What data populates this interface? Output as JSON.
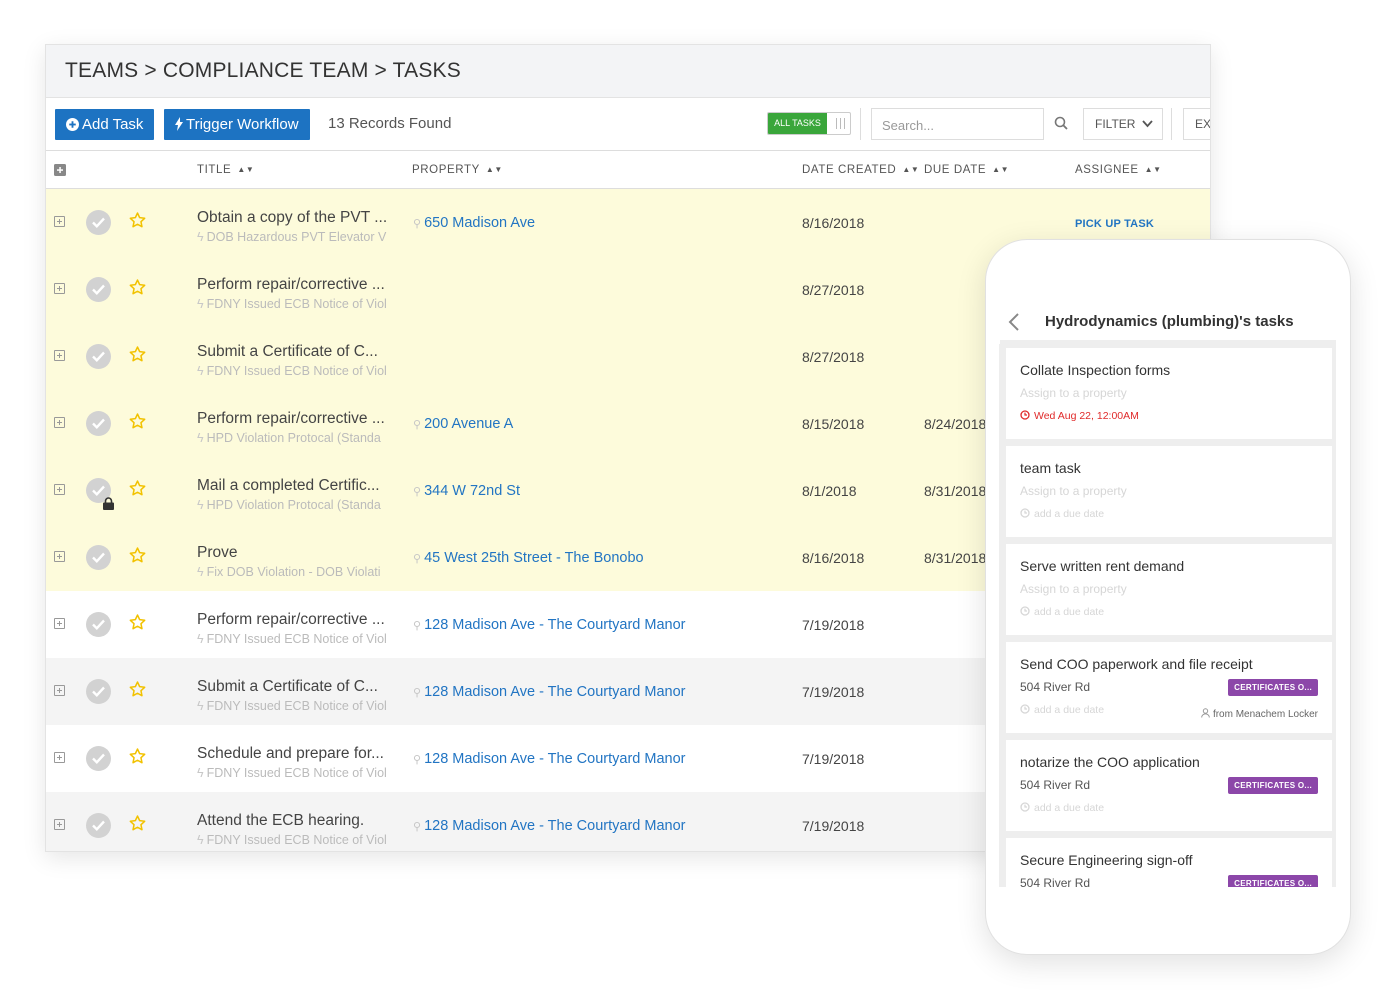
{
  "breadcrumb": "TEAMS > COMPLIANCE TEAM > TASKS",
  "toolbar": {
    "add_task": "Add Task",
    "trigger_workflow": "Trigger Workflow",
    "records": "13 Records Found",
    "toggle_label": "ALL TASKS",
    "search_placeholder": "Search...",
    "filter": "FILTER",
    "export": "EX"
  },
  "columns": {
    "title": "TITLE",
    "property": "PROPERTY",
    "date_created": "DATE CREATED",
    "due_date": "DUE DATE",
    "assignee": "ASSIGNEE"
  },
  "rows": [
    {
      "title": "Obtain a copy of the PVT ...",
      "sub": "DOB Hazardous PVT Elevator V",
      "property": "650 Madison Ave",
      "date_created": "8/16/2018",
      "due_date": "",
      "assignee": "PICK UP TASK",
      "locked": false
    },
    {
      "title": "Perform repair/corrective ...",
      "sub": "FDNY Issued ECB Notice of Viol",
      "property": "",
      "date_created": "8/27/2018",
      "due_date": "",
      "assignee": "",
      "locked": false
    },
    {
      "title": "Submit a Certificate of C...",
      "sub": "FDNY Issued ECB Notice of Viol",
      "property": "",
      "date_created": "8/27/2018",
      "due_date": "",
      "assignee": "",
      "locked": false
    },
    {
      "title": "Perform repair/corrective ...",
      "sub": "HPD Violation Protocal (Standa",
      "property": "200 Avenue A",
      "date_created": "8/15/2018",
      "due_date": "8/24/2018",
      "assignee": "",
      "locked": false
    },
    {
      "title": "Mail a completed Certific...",
      "sub": "HPD Violation Protocal (Standa",
      "property": "344 W 72nd St",
      "date_created": "8/1/2018",
      "due_date": "8/31/2018",
      "assignee": "",
      "locked": true
    },
    {
      "title": "Prove",
      "sub": "Fix DOB Violation - DOB Violati",
      "property": "45 West 25th Street - The Bonobo",
      "date_created": "8/16/2018",
      "due_date": "8/31/2018",
      "assignee": "",
      "locked": false
    },
    {
      "title": "Perform repair/corrective ...",
      "sub": "FDNY Issued ECB Notice of Viol",
      "property": "128 Madison Ave - The Courtyard Manor",
      "date_created": "7/19/2018",
      "due_date": "",
      "assignee": "",
      "locked": false
    },
    {
      "title": "Submit a Certificate of C...",
      "sub": "FDNY Issued ECB Notice of Viol",
      "property": "128 Madison Ave - The Courtyard Manor",
      "date_created": "7/19/2018",
      "due_date": "",
      "assignee": "",
      "locked": false
    },
    {
      "title": "Schedule and prepare for...",
      "sub": "FDNY Issued ECB Notice of Viol",
      "property": "128 Madison Ave - The Courtyard Manor",
      "date_created": "7/19/2018",
      "due_date": "",
      "assignee": "",
      "locked": false
    },
    {
      "title": "Attend the ECB hearing.",
      "sub": "FDNY Issued ECB Notice of Viol",
      "property": "128 Madison Ave - The Courtyard Manor",
      "date_created": "7/19/2018",
      "due_date": "",
      "assignee": "",
      "locked": false
    }
  ],
  "phone": {
    "title": "Hydrodynamics (plumbing)'s tasks",
    "cards": [
      {
        "title": "Collate Inspection forms",
        "property": "Assign to a property",
        "date": "Wed Aug 22, 12:00AM",
        "badge": "",
        "from": ""
      },
      {
        "title": "team task",
        "property": "Assign to a property",
        "date": "add a due date",
        "badge": "",
        "from": ""
      },
      {
        "title": "Serve written rent demand",
        "property": "Assign to a property",
        "date": "add a due date",
        "badge": "",
        "from": ""
      },
      {
        "title": "Send COO paperwork and file receipt",
        "property": "504 River Rd",
        "date": "add a due date",
        "badge": "CERTIFICATES O...",
        "from": "from Menachem Locker"
      },
      {
        "title": "notarize the COO application",
        "property": "504 River Rd",
        "date": "add a due date",
        "badge": "CERTIFICATES O...",
        "from": ""
      },
      {
        "title": "Secure Engineering sign-off",
        "property": "504 River Rd",
        "date": "",
        "badge": "CERTIFICATES O...",
        "from": ""
      }
    ]
  },
  "colors": {
    "primary": "#1d73c2",
    "link": "#2275c3",
    "highlight_row": "#fdfbdb",
    "toggle_on": "#3aa63b",
    "badge": "#8c47a9",
    "overdue": "#e02a2a",
    "star": "#f2c200"
  },
  "icons": {
    "add": "plus-circle-icon",
    "workflow": "bolt-icon",
    "search": "search-icon",
    "filter": "chevron-down-icon",
    "complete": "check-circle-icon",
    "favorite": "star-icon",
    "expand": "plus-square-icon",
    "lock": "lock-icon",
    "location": "map-pin-icon",
    "back": "chevron-left-icon",
    "clock": "clock-icon",
    "user": "user-icon"
  }
}
